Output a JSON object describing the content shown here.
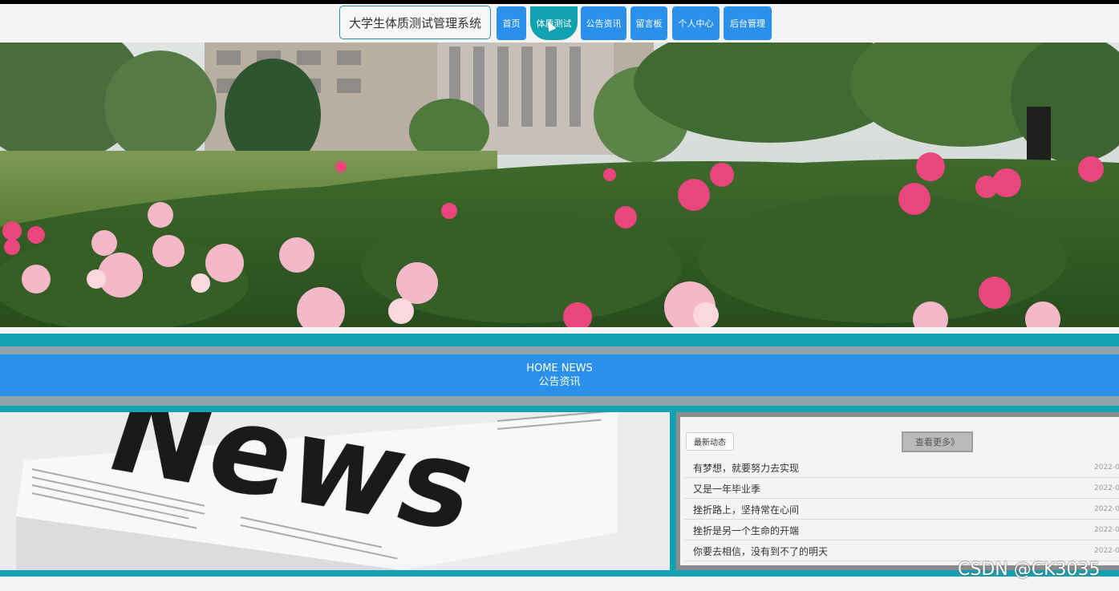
{
  "header": {
    "site_title": "大学生体质测试管理系统",
    "nav": [
      {
        "label": "首页",
        "active": false
      },
      {
        "label": "体质测试",
        "active": true
      },
      {
        "label": "公告资讯",
        "active": false
      },
      {
        "label": "留言板",
        "active": false
      },
      {
        "label": "个人中心",
        "active": false
      },
      {
        "label": "后台管理",
        "active": false
      }
    ]
  },
  "section": {
    "title_en": "HOME NEWS",
    "title_cn": "公告资讯"
  },
  "news": {
    "tag": "最新动态",
    "more": "查看更多》",
    "items": [
      {
        "title": "有梦想，就要努力去实现",
        "date": "2022-0"
      },
      {
        "title": "又是一年毕业季",
        "date": "2022-0"
      },
      {
        "title": "挫折路上，坚持常在心间",
        "date": "2022-0"
      },
      {
        "title": "挫折是另一个生命的开端",
        "date": "2022-0"
      },
      {
        "title": "你要去相信，没有到不了的明天",
        "date": "2022-0"
      }
    ]
  },
  "news_image": {
    "headline": "News"
  },
  "watermark": "CSDN @CK3035",
  "colors": {
    "accent_blue": "#2a90ea",
    "accent_teal": "#12a1b0",
    "band_gray": "#8ea3ac"
  }
}
